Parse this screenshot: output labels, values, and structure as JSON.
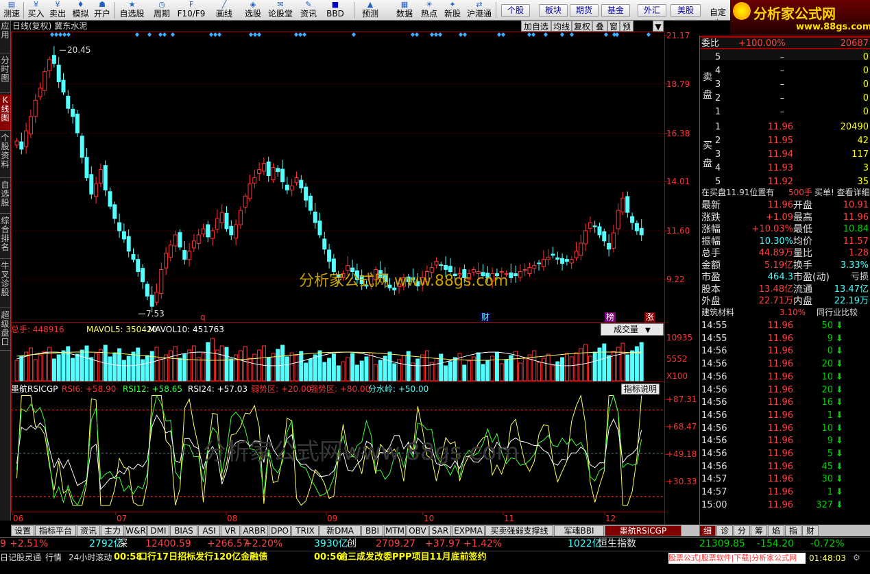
{
  "toolbar": {
    "items": [
      {
        "icon": "monitor-icon",
        "label": "测速"
      },
      {
        "icon": "buy-icon",
        "label": "买入"
      },
      {
        "icon": "sell-icon",
        "label": "卖出"
      },
      {
        "icon": "simulate-icon",
        "label": "模拟"
      },
      {
        "icon": "open-account-icon",
        "label": "开户"
      },
      {
        "icon": "watchlist-icon",
        "label": "自选股"
      },
      {
        "icon": "period-icon",
        "label": "周期"
      },
      {
        "icon": "function-key-icon",
        "label": "F10/F9"
      },
      {
        "icon": "draw-line-icon",
        "label": "画线"
      },
      {
        "icon": "select-stock-icon",
        "label": "选股"
      },
      {
        "icon": "forum-icon",
        "label": "论股堂"
      },
      {
        "icon": "news-icon",
        "label": "资讯"
      },
      {
        "icon": "bbd-icon",
        "label": "BBD"
      },
      {
        "icon": "alert-icon",
        "label": "预测"
      },
      {
        "icon": "data-icon",
        "label": "数据"
      },
      {
        "icon": "hotspot-icon",
        "label": "热点"
      },
      {
        "icon": "ipo-icon",
        "label": "新股"
      },
      {
        "icon": "hk-connect-icon",
        "label": "沪港通"
      }
    ],
    "market_tabs": [
      "个股",
      "板块",
      "期货",
      "基金",
      "外汇",
      "美股"
    ],
    "custom": "自定义"
  },
  "logo": {
    "text": "分析家公式网",
    "url": "www.88gs.com"
  },
  "left_nav": [
    "应用",
    "分时图",
    "K线图",
    "个股资料",
    "自选股",
    "综合排名",
    "牛叉诊股",
    "超级盘口"
  ],
  "chart": {
    "title": "日线(复权)",
    "stock_name": "冀东水泥",
    "buttons": [
      "加自选",
      "均线",
      "复权",
      "叠",
      "窗",
      "预测"
    ],
    "price_axis": [
      "21.17",
      "18.79",
      "16.38",
      "14.01",
      "11.60",
      "9.22"
    ],
    "high_label": "20.45",
    "low_label": "7.53",
    "markers": [
      "q",
      "财",
      "榜",
      "涨"
    ],
    "volume": {
      "label_total": "总手: 448916",
      "mavol5": "MAVOL5: 350420",
      "mavol10": "MAVOL10: 451763",
      "dropdown": "成交量",
      "axis": [
        "10935",
        "5552",
        "X100"
      ]
    },
    "indicator": {
      "name": "墨航RSICGP",
      "rsi6": "RSI6: +58.90",
      "rsi12": "RSI12: +58.65",
      "rsi24": "RSI24: +57.03",
      "weak": "弱势区: +20.00",
      "strong": "强势区: +80.00",
      "water": "分水岭: +50.00",
      "explain_btn": "指标说明",
      "axis": [
        "+87.31",
        "+68.47",
        "+49.18",
        "+30.33"
      ]
    },
    "date_axis": [
      "06",
      "07",
      "08",
      "09",
      "10",
      "11",
      "12"
    ],
    "watermark_top": "分析家公式网  www.88gs.com",
    "watermark_bottom": "分析家公式网www.88gs.com"
  },
  "chart_data": {
    "type": "candlestick",
    "price_range": [
      7.2,
      21.3
    ],
    "high": 20.45,
    "low": 7.53,
    "indicator_range": [
      10,
      95
    ]
  },
  "quote": {
    "weibi_label": "委比",
    "weibi": "+100.00%",
    "weicha": "20687",
    "sell_label": "卖盘",
    "buy_label": "买盘",
    "sells": [
      {
        "n": "5",
        "p": "–",
        "v": "0"
      },
      {
        "n": "4",
        "p": "–",
        "v": "0"
      },
      {
        "n": "3",
        "p": "–",
        "v": "0"
      },
      {
        "n": "2",
        "p": "–",
        "v": "0"
      },
      {
        "n": "1",
        "p": "–",
        "v": "0"
      }
    ],
    "buys": [
      {
        "n": "1",
        "p": "11.96",
        "v": "20490"
      },
      {
        "n": "2",
        "p": "11.95",
        "v": "42"
      },
      {
        "n": "3",
        "p": "11.94",
        "v": "117"
      },
      {
        "n": "4",
        "p": "11.93",
        "v": "3"
      },
      {
        "n": "5",
        "p": "11.92",
        "v": "35"
      }
    ],
    "note_left": "在买盘11.91位置有",
    "note_mid": "500手",
    "note_right": "买单! 查看详细",
    "stats": [
      {
        "l1": "最新",
        "v1": "11.96",
        "l2": "开盘",
        "v2": "10.91"
      },
      {
        "l1": "涨跌",
        "v1": "+1.09",
        "l2": "最高",
        "v2": "11.96"
      },
      {
        "l1": "涨幅",
        "v1": "+10.03%",
        "l2": "最低",
        "v2": "10.84"
      },
      {
        "l1": "振幅",
        "v1": "10.30%",
        "l2": "均价",
        "v2": "11.57"
      },
      {
        "l1": "总手",
        "v1": "44.89万",
        "l2": "量比",
        "v2": "1.28"
      },
      {
        "l1": "金额",
        "v1": "5.19亿",
        "l2": "换手",
        "v2": "3.33%"
      },
      {
        "l1": "市盈",
        "v1": "464.3",
        "l2": "市盈(动)",
        "v2": "亏损"
      },
      {
        "l1": "股本",
        "v1": "13.48亿",
        "l2": "流通",
        "v2": "13.47亿"
      },
      {
        "l1": "外盘",
        "v1": "22.71万",
        "l2": "内盘",
        "v2": "22.19万"
      }
    ],
    "sector": "建筑材料",
    "sector_pct": "3.10%",
    "compare": "同行业比较",
    "ticks": [
      {
        "t": "14:55",
        "p": "11.96",
        "v": "50"
      },
      {
        "t": "14:55",
        "p": "11.96",
        "v": "9"
      },
      {
        "t": "14:56",
        "p": "11.96",
        "v": "0"
      },
      {
        "t": "14:56",
        "p": "11.96",
        "v": "20"
      },
      {
        "t": "14:56",
        "p": "11.96",
        "v": "10"
      },
      {
        "t": "14:56",
        "p": "11.96",
        "v": "20"
      },
      {
        "t": "14:56",
        "p": "11.96",
        "v": "16"
      },
      {
        "t": "14:56",
        "p": "11.96",
        "v": "1"
      },
      {
        "t": "14:56",
        "p": "11.96",
        "v": "10"
      },
      {
        "t": "14:56",
        "p": "11.96",
        "v": "9"
      },
      {
        "t": "14:56",
        "p": "11.96",
        "v": "5"
      },
      {
        "t": "14:56",
        "p": "11.96",
        "v": "45"
      },
      {
        "t": "14:57",
        "p": "11.96",
        "v": "30"
      },
      {
        "t": "14:57",
        "p": "11.96",
        "v": "1"
      },
      {
        "t": "15:00",
        "p": "11.96",
        "v": "327"
      }
    ],
    "tabs": [
      "细",
      "诊",
      "分",
      "筹",
      "焰",
      "指",
      "财"
    ]
  },
  "bottom_tabs": [
    "设置",
    "指标平台",
    "资讯",
    "主力",
    "W&R",
    "DMI",
    "BIAS",
    "ASI",
    "VR",
    "ARBR",
    "DPO",
    "TRIX",
    "新DMA",
    "BBI",
    "MTM",
    "OBV",
    "SAR",
    "EXPMA",
    "买卖强弱支撑线",
    "军魂BBI",
    "墨航RSICGP"
  ],
  "index_bar": [
    {
      "text": "9",
      "cls": "red"
    },
    {
      "text": "+2.51%",
      "cls": "red"
    },
    {
      "text": "2792亿",
      "cls": "cyn"
    },
    {
      "text": "深",
      "cls": "wht"
    },
    {
      "text": "12400.59",
      "cls": "red"
    },
    {
      "text": "+266.57",
      "cls": "red"
    },
    {
      "text": "+2.20%",
      "cls": "red"
    },
    {
      "text": "3930亿",
      "cls": "cyn"
    },
    {
      "text": "创",
      "cls": "wht"
    },
    {
      "text": "2709.27",
      "cls": "red"
    },
    {
      "text": "+37.97",
      "cls": "red"
    },
    {
      "text": "+1.42%",
      "cls": "red"
    },
    {
      "text": "1022亿",
      "cls": "cyn"
    },
    {
      "text": "恒生指数",
      "cls": "wht"
    },
    {
      "text": "21309.85",
      "cls": "grn"
    },
    {
      "text": "-154.20",
      "cls": "grn"
    },
    {
      "text": "-0.72%",
      "cls": "grn"
    }
  ],
  "news_bar": {
    "left_tabs": [
      "日记",
      "股灵通",
      "行情",
      "24小时滚动"
    ],
    "news1_time": "00:58",
    "news1": "口行17日招标发行120亿金融债",
    "news2_time": "00:56",
    "news2": "逾三成发改委PPP项目11月底前签约",
    "right": "股票公式|股票软件|下载|分析家公式网",
    "clock": "01:48:03"
  }
}
